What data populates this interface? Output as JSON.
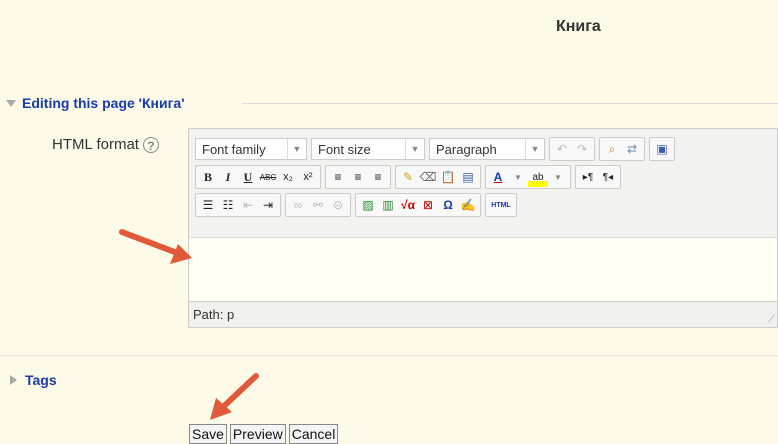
{
  "page": {
    "title": "Книга"
  },
  "editing_section": {
    "legend": "Editing this page 'Книга'",
    "field_label": "HTML format",
    "help_icon": "?"
  },
  "editor": {
    "font_family": "Font family",
    "font_size": "Font size",
    "paragraph": "Paragraph",
    "path": "Path: p",
    "toolbar_icons": {
      "bold": "B",
      "italic": "I",
      "underline": "U",
      "strike": "ABC",
      "subscript": "x₂",
      "superscript": "x²",
      "html": "HTML",
      "omega": "Ω"
    }
  },
  "tags_section": {
    "label": "Tags"
  },
  "buttons": {
    "save": "Save",
    "preview": "Preview",
    "cancel": "Cancel"
  },
  "colors": {
    "arrow": "#e05a3a",
    "link": "#1a3aa8",
    "page_bg": "#fdfbe8"
  }
}
